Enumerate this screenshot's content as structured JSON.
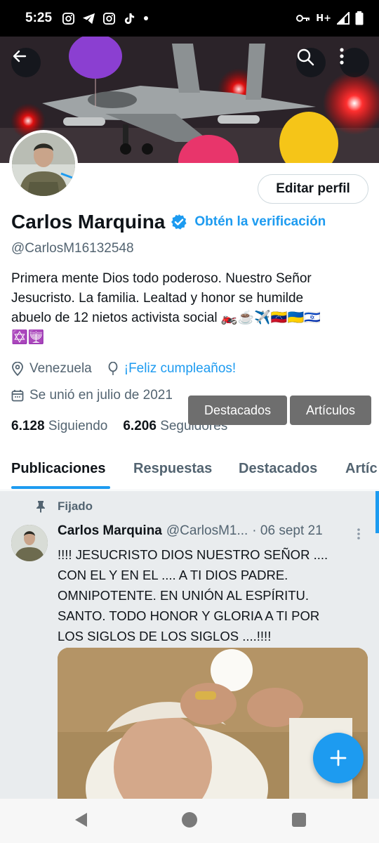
{
  "status_bar": {
    "time": "5:25",
    "network": "H+"
  },
  "profile": {
    "name": "Carlos Marquina",
    "verify_cta": "Obtén la verificación",
    "handle": "@CarlosM16132548",
    "edit_button": "Editar perfil",
    "bio_lines": [
      "Primera mente Dios todo poderoso. Nuestro Señor",
      "Jesucristo. La familia. Lealtad y honor se humilde",
      "abuelo de 12 nietos  activista social 🏍️☕✈️🇻🇪🇺🇦🇮🇱",
      "✡️🕎"
    ],
    "location": "Venezuela",
    "birthday": "¡Feliz cumpleaños!",
    "joined": "Se unió en julio de 2021",
    "following_count": "6.128",
    "following_label": "Siguiendo",
    "followers_count": "6.206",
    "followers_label": "Seguidores"
  },
  "tooltips": {
    "destacados": "Destacados",
    "articulos": "Artículos"
  },
  "tabs": [
    {
      "label": "Publicaciones",
      "active": true
    },
    {
      "label": "Respuestas",
      "active": false
    },
    {
      "label": "Destacados",
      "active": false
    },
    {
      "label": "Artíc",
      "active": false
    }
  ],
  "pinned_tweet": {
    "pinned_label": "Fijado",
    "author_name": "Carlos Marquina",
    "author_handle": "@CarlosM1...",
    "date": "· 06 sept 21",
    "text_lines": [
      "!!!!  JESUCRISTO  DIOS NUESTRO SEÑOR ....",
      "CON  EL  Y  EN  EL .... A  TI  DIOS   PADRE.",
      "OMNIPOTENTE. EN UNIÓN AL ESPÍRITU.",
      "SANTO. TODO HONOR Y GLORIA  A TI  POR",
      "LOS SIGLOS DE LOS SIGLOS ....!!!!"
    ]
  },
  "colors": {
    "accent": "#1d9bf0",
    "text_primary": "#0f1419",
    "text_secondary": "#536471",
    "balloon_purple": "#8b3fd1",
    "balloon_pink": "#e8356b",
    "balloon_yellow": "#f5c518"
  },
  "icons": {
    "back": "arrow-left-icon",
    "search": "search-icon",
    "more": "more-vertical-icon",
    "verified": "verified-badge-icon",
    "location": "location-pin-icon",
    "birthday": "balloon-icon",
    "calendar": "calendar-icon",
    "pin": "pin-icon",
    "compose": "plus-icon"
  }
}
